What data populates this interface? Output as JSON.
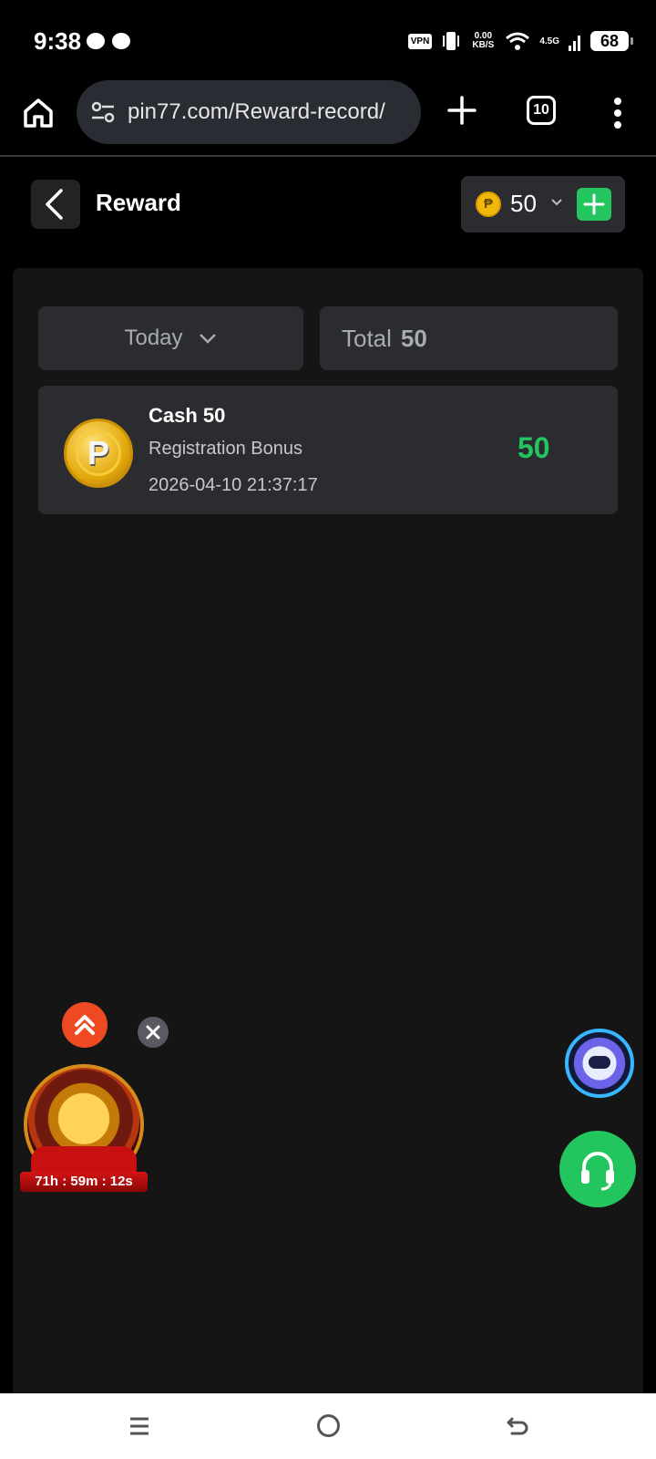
{
  "status_bar": {
    "time": "9:38",
    "net_speed": "0.00 KB/S",
    "network": "4.5G",
    "vpn": "VPN",
    "battery": "68",
    "icons": [
      "chat-bubble-icon",
      "messenger-icon",
      "vpn-icon",
      "vibrate-icon",
      "wifi-icon",
      "signal-icon",
      "battery-icon"
    ]
  },
  "browser": {
    "url": "pin77.com/Reward-record/",
    "tab_count": "10",
    "icons": [
      "home-icon",
      "site-settings-icon",
      "plus-icon",
      "tabs-icon",
      "more-vert-icon"
    ]
  },
  "header": {
    "title": "Reward",
    "balance": "50",
    "currency_symbol": "₱"
  },
  "filters": {
    "date_range": "Today",
    "total_label": "Total",
    "total_value": "50"
  },
  "records": [
    {
      "title": "Cash 50",
      "type": "Registration Bonus",
      "time": "2026-04-10 21:37:17",
      "amount": "50",
      "coin_letter": "P"
    }
  ],
  "promo": {
    "countdown": "71h : 59m : 12s"
  },
  "colors": {
    "accent_green": "#22c55e",
    "panel": "#151516",
    "card": "#2b2c30",
    "scroll_top": "#ee4a21"
  }
}
